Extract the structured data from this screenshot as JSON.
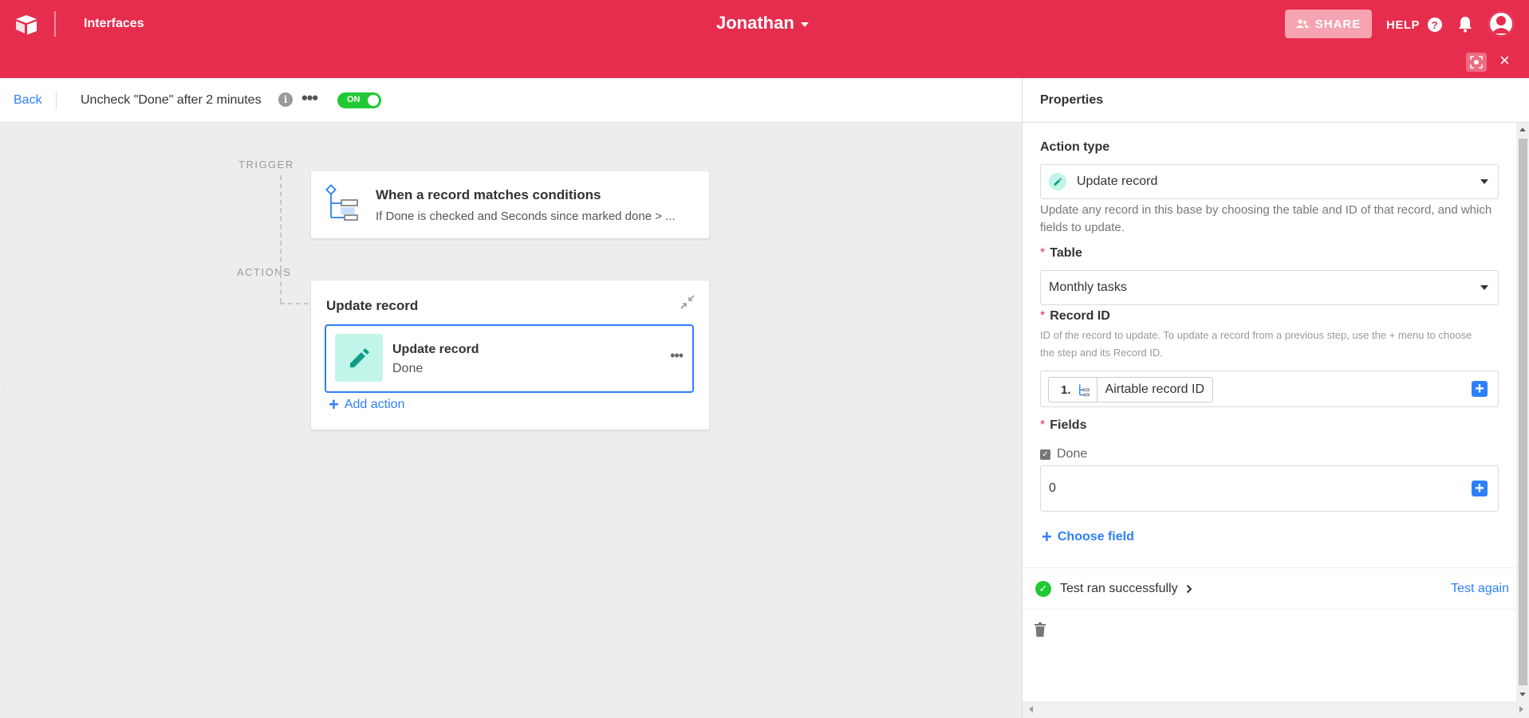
{
  "topbar": {
    "app_section": "Interfaces",
    "base_name": "Jonathan",
    "share_label": "SHARE",
    "help_label": "HELP",
    "help_glyph": "?",
    "close_glyph": "×"
  },
  "header": {
    "back_label": "Back",
    "automation_name": "Uncheck \"Done\" after 2 minutes",
    "info_glyph": "i",
    "more_glyph": "•••",
    "toggle_label": "ON",
    "toggle_on": true
  },
  "canvas": {
    "trigger_label": "TRIGGER",
    "actions_label": "ACTIONS",
    "trigger": {
      "title": "When a record matches conditions",
      "subtitle": "If Done is checked and Seconds since marked done > ..."
    },
    "actions_card": {
      "title": "Update record",
      "step": {
        "title": "Update record",
        "subtitle": "Done",
        "more_glyph": "•••"
      },
      "add_action_label": "Add action",
      "plus_glyph": "+"
    }
  },
  "properties": {
    "title": "Properties",
    "action_type_label": "Action type",
    "action_type_value": "Update record",
    "description": "Update any record in this base by choosing the table and ID of that record, and which fields to update.",
    "required_marker": "*",
    "table_label": "Table",
    "table_value": "Monthly tasks",
    "record_id_label": "Record ID",
    "record_id_help": "ID of the record to update. To update a record from a previous step, use the + menu to choose the step and its Record ID.",
    "record_token": {
      "step_number": "1.",
      "field": "Airtable record ID"
    },
    "fields_label": "Fields",
    "field_item": {
      "name": "Done",
      "value": "0"
    },
    "choose_field_label": "Choose field",
    "plus_glyph": "+",
    "test_status": "Test ran successfully",
    "test_again_label": "Test again",
    "check_glyph": "✓"
  },
  "colors": {
    "brand": "#e62d4e",
    "link": "#2d7ff9",
    "success": "#20c933",
    "step_icon_bg": "#c2f5e9",
    "canvas_bg": "#ededed"
  },
  "icons": [
    "airtable-logo-icon",
    "caret-down-icon",
    "share-users-icon",
    "help-icon",
    "bell-icon",
    "avatar-icon",
    "fullscreen-icon",
    "close-icon",
    "info-icon",
    "more-icon",
    "trigger-conditions-icon",
    "collapse-icon",
    "pencil-icon",
    "plus-icon",
    "checkbox-icon",
    "check-circle-icon",
    "chevron-right-icon",
    "trash-icon"
  ]
}
